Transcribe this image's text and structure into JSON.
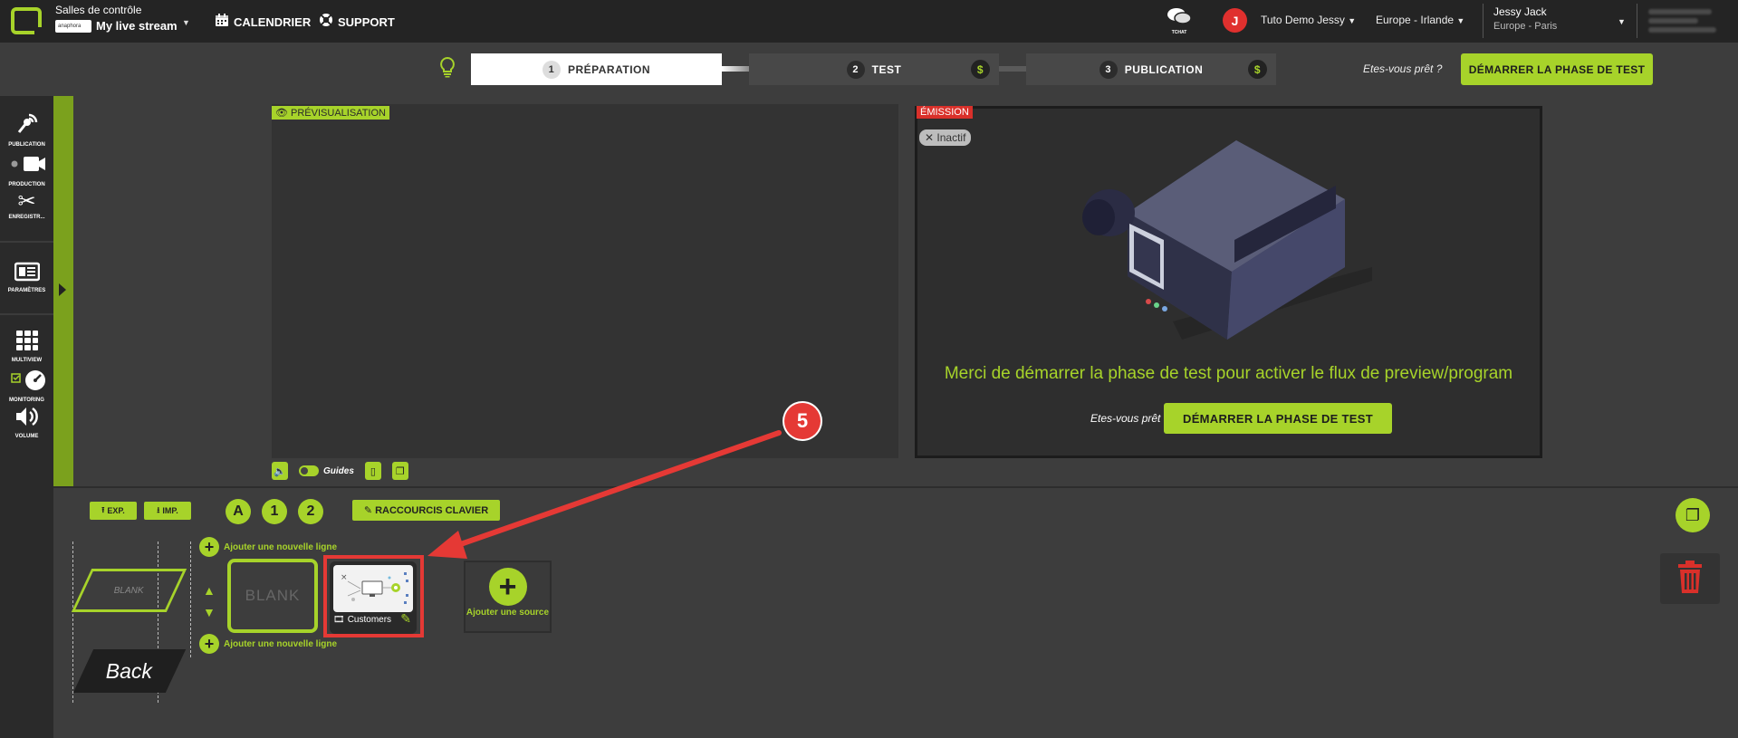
{
  "topbar": {
    "rooms_title": "Salles de contrôle",
    "brand_small": "anaphora",
    "stream_name": "My live stream",
    "nav": [
      {
        "label": "CALENDRIER",
        "icon": "calendar-icon"
      },
      {
        "label": "SUPPORT",
        "icon": "lifebuoy-icon"
      }
    ],
    "chat_label": "TCHAT",
    "account_initial": "J",
    "account_name": "Tuto Demo Jessy",
    "region": "Europe - Irlande",
    "user_name": "Jessy Jack",
    "user_timezone": "Europe - Paris"
  },
  "steps": [
    {
      "num": "1",
      "label": "PRÉPARATION",
      "active": true
    },
    {
      "num": "2",
      "label": "TEST",
      "active": false,
      "paid": "$"
    },
    {
      "num": "3",
      "label": "PUBLICATION",
      "active": false,
      "paid": "$"
    }
  ],
  "ready_question": "Etes-vous prêt ?",
  "start_test_label": "DÉMARRER LA PHASE DE TEST",
  "sidebar": [
    {
      "label": "PUBLICATION",
      "icon": "broadcast-icon"
    },
    {
      "label": "PRODUCTION",
      "icon": "camera-icon"
    },
    {
      "label": "ENREGISTR...",
      "icon": "scissors-icon"
    },
    {
      "label": "PARAMÈTRES",
      "icon": "settings-icon"
    },
    {
      "label": "MULTIVIEW",
      "icon": "grid-icon"
    },
    {
      "label": "MONITORING",
      "icon": "gauge-icon"
    },
    {
      "label": "VOLUME",
      "icon": "volume-icon"
    }
  ],
  "preview": {
    "tag": "PRÉVISUALISATION",
    "guides_label": "Guides"
  },
  "emission": {
    "tag": "ÉMISSION",
    "status": "Inactif",
    "message": "Merci de démarrer la phase de test pour activer le flux de preview/program",
    "ready": "Etes-vous prêt",
    "start_label": "DÉMARRER LA PHASE DE TEST"
  },
  "lower": {
    "export_label": "EXP.",
    "import_label": "IMP.",
    "layout_buttons": [
      "A",
      "1",
      "2"
    ],
    "shortcuts_label": "RACCOURCIS CLAVIER",
    "add_line_label": "Ajouter une nouvelle ligne",
    "blank_label": "BLANK",
    "back_label": "Back",
    "blank_tile_label": "BLANK",
    "source_name": "Customers",
    "add_source_label": "Ajouter une source"
  },
  "annotation": {
    "number": "5"
  },
  "colors": {
    "accent": "#a7d32a",
    "danger": "#e53935",
    "background": "#3d3d3d",
    "topbar": "#242424"
  }
}
